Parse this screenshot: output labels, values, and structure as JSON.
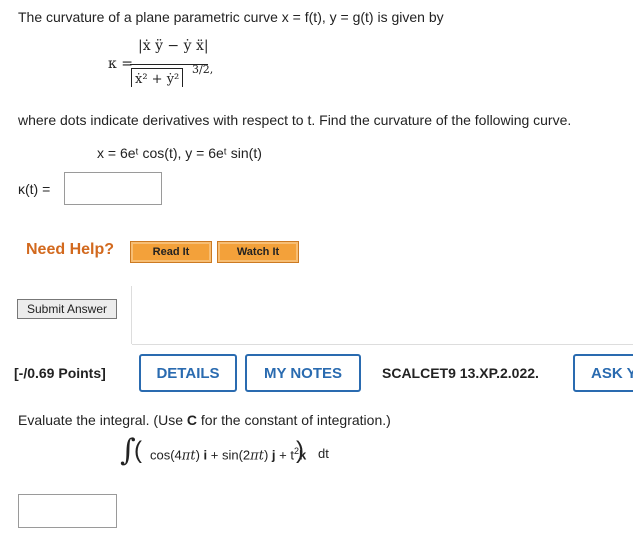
{
  "q1": {
    "intro": "The curvature of a plane parametric curve x = f(t), y = g(t) is given by",
    "formula": {
      "kappa": "κ =",
      "numerator": "|ẋ ÿ − ẏ ẍ|",
      "denominator": "ẋ² + ẏ²",
      "exponent": "3/2",
      "trailing": ","
    },
    "description": "where dots indicate derivatives with respect to t. Find the curvature of the following curve.",
    "equation": "x = 6eᵗ cos(t),   y = 6eᵗ sin(t)",
    "answer_label": "κ(t)  =",
    "answer_value": "",
    "need_help": "Need Help?",
    "read_it": "Read It",
    "watch_it": "Watch It",
    "submit": "Submit Answer"
  },
  "q2": {
    "points": "[-/0.69 Points]",
    "details": "DETAILS",
    "my_notes": "MY NOTES",
    "code": "SCALCET9 13.XP.2.022.",
    "ask": "ASK Y",
    "instruction_pre": "Evaluate the integral. (Use ",
    "instruction_bold": "C",
    "instruction_post": " for the constant of integration.)",
    "integral": {
      "sign": "∫",
      "open": "(",
      "term1_pre": "cos(4",
      "term1_pi": "πt",
      "term1_post": ") ",
      "i": "i",
      "plus1": " + sin(2",
      "term2_pi": "πt",
      "term2_post": ") ",
      "j": "j",
      "plus2": " + t",
      "sq": "2",
      "k": "k",
      "close": ")",
      "dt": "dt"
    },
    "answer_value": ""
  },
  "colors": {
    "accent_blue": "#2a6bb0",
    "help_orange": "#d2691e",
    "button_orange": "#f3a13a"
  }
}
